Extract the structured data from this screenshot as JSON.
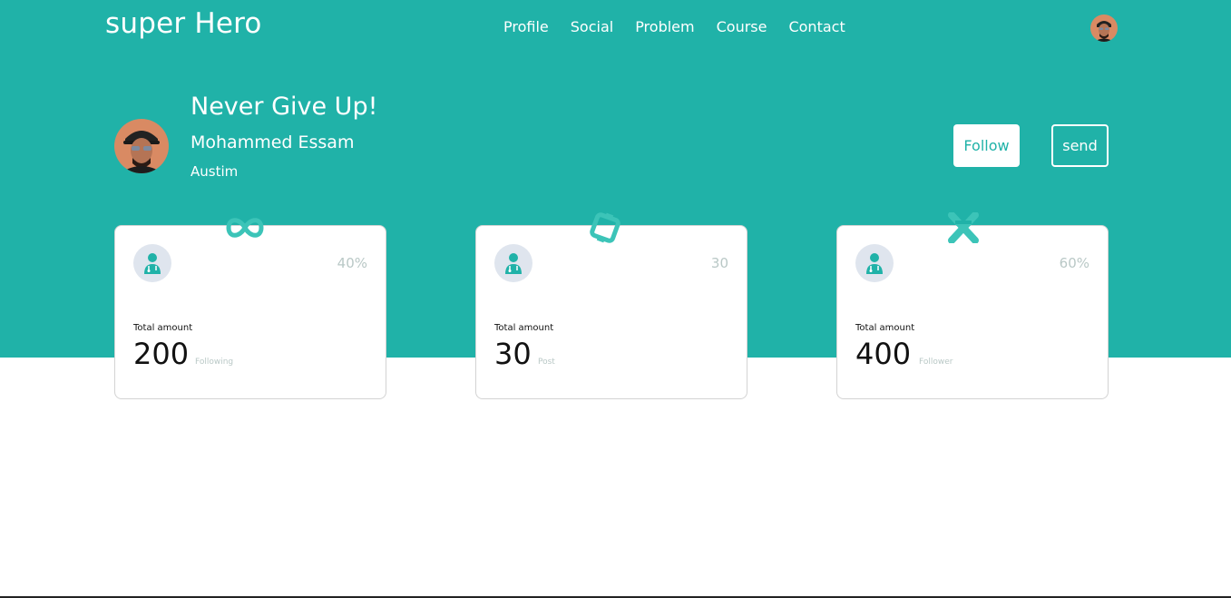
{
  "header": {
    "brand": "super Hero",
    "nav": [
      "Profile",
      "Social",
      "Problem",
      "Course",
      "Contact"
    ]
  },
  "profile": {
    "tagline": "Never Give Up!",
    "name": "Mohammed Essam",
    "location": "Austim"
  },
  "actions": {
    "follow_label": "Follow",
    "send_label": "send"
  },
  "cards": [
    {
      "percent": "40%",
      "total_label": "Total amount",
      "value": "200",
      "unit": "Following",
      "icon": "infinity-icon"
    },
    {
      "percent": "30",
      "total_label": "Total amount",
      "value": "30",
      "unit": "Post",
      "icon": "ring-icon"
    },
    {
      "percent": "60%",
      "total_label": "Total amount",
      "value": "400",
      "unit": "Follower",
      "icon": "cross-icon"
    }
  ],
  "colors": {
    "accent": "#20b2a8",
    "muted": "#b9c8c6",
    "icon_bg": "#dfe5ee"
  }
}
